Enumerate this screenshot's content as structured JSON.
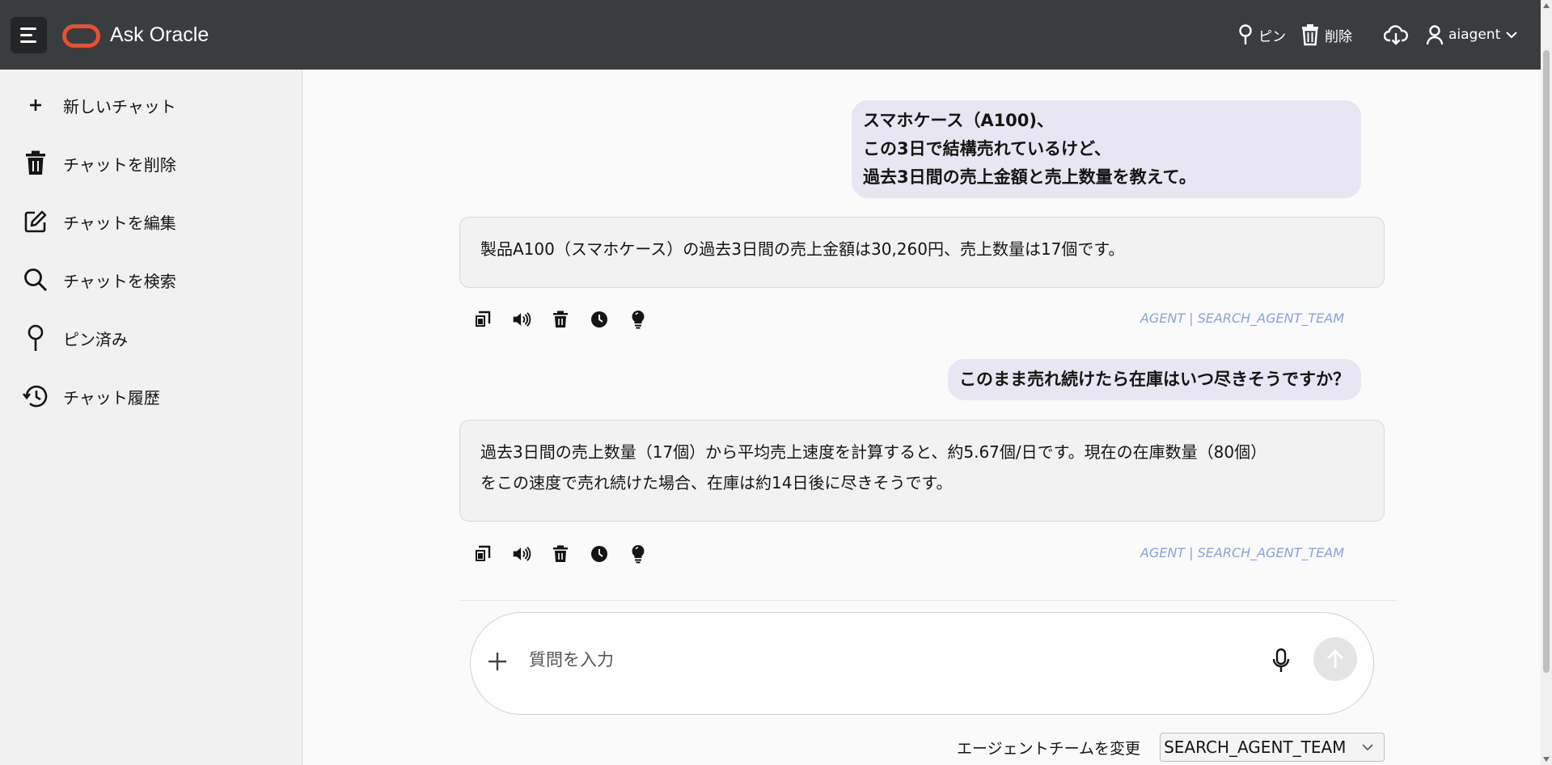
{
  "header": {
    "title": "Ask Oracle",
    "pin_label": "ピン",
    "delete_label": "削除",
    "user_name": "aiagent"
  },
  "sidebar": {
    "items": [
      {
        "label": "新しいチャット",
        "icon": "plus-icon"
      },
      {
        "label": "チャットを削除",
        "icon": "trash-icon"
      },
      {
        "label": "チャットを編集",
        "icon": "edit-icon"
      },
      {
        "label": "チャットを検索",
        "icon": "search-icon"
      },
      {
        "label": "ピン済み",
        "icon": "pin-icon"
      },
      {
        "label": "チャット履歴",
        "icon": "history-icon"
      }
    ]
  },
  "chat": {
    "messages": [
      {
        "role": "user",
        "lines": [
          "スマホケース（A100)、",
          "この3日で結構売れているけど、",
          "過去3日間の売上金額と売上数量を教えて。"
        ]
      },
      {
        "role": "agent",
        "lines": [
          "製品A100（スマホケース）の過去3日間の売上金額は30,260円、売上数量は17個です。"
        ],
        "agent_tag": "AGENT | SEARCH_AGENT_TEAM"
      },
      {
        "role": "user",
        "lines": [
          "このまま売れ続けたら在庫はいつ尽きそうですか？"
        ]
      },
      {
        "role": "agent",
        "lines": [
          "過去3日間の売上数量（17個）から平均売上速度を計算すると、約5.67個/日です。現在の在庫数量（80個）",
          "をこの速度で売れ続けた場合、在庫は約14日後に尽きそうです。"
        ],
        "agent_tag": "AGENT | SEARCH_AGENT_TEAM"
      }
    ]
  },
  "composer": {
    "placeholder": "質問を入力",
    "value": ""
  },
  "team": {
    "label": "エージェントチームを変更",
    "selected": "SEARCH_AGENT_TEAM"
  },
  "colors": {
    "header_bg": "#3a3d3f",
    "brand": "#e8502f",
    "user_bubble": "#e8e6f3",
    "agent_tag": "#8ba2d8"
  }
}
